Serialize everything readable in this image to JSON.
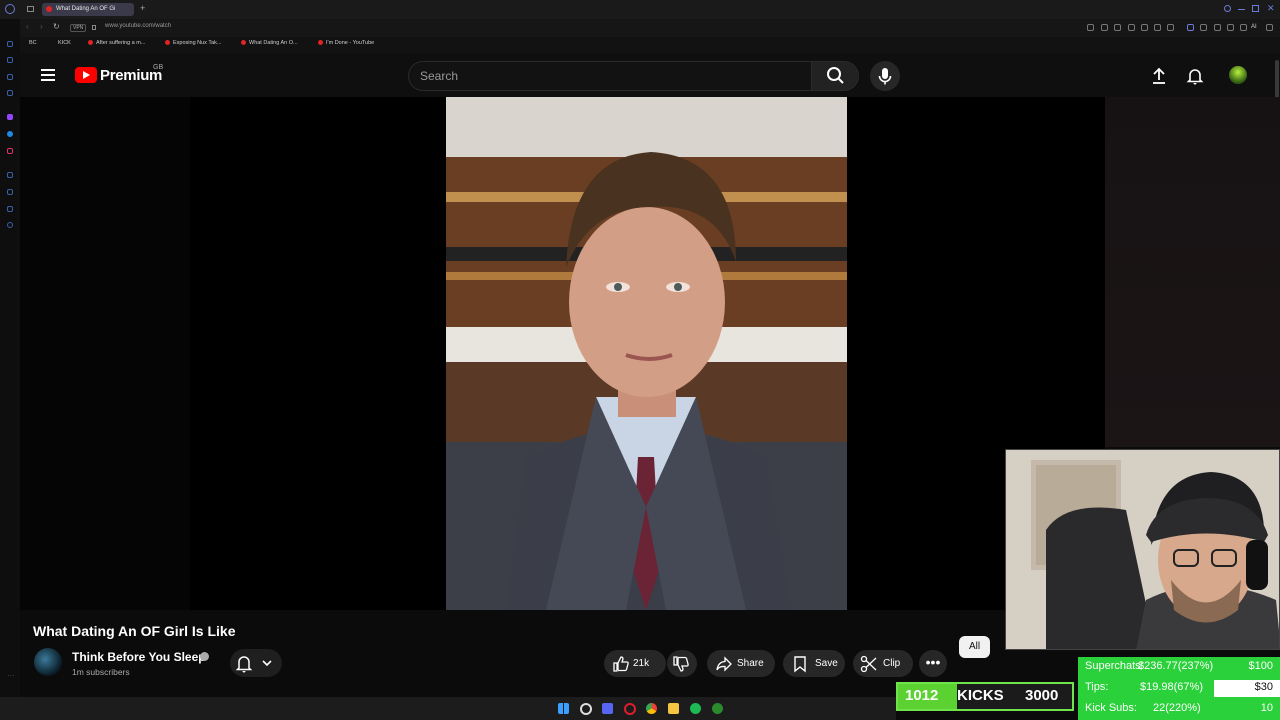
{
  "browser": {
    "tab_title": "What Dating An OF Gi",
    "url": "www.youtube.com/watch",
    "vpn_label": "VPN",
    "bookmarks": [
      "BC",
      "KICK",
      "After suffering a m...",
      "Exposing Nux Tak...",
      "What Dating An O...",
      "I'm Done - YouTube"
    ]
  },
  "header": {
    "brand": "Premium",
    "region": "GB",
    "search_placeholder": "Search"
  },
  "video": {
    "title": "What Dating An OF Girl Is Like",
    "channel": "Think Before You Sleep",
    "subscribers": "1m subscribers",
    "likes": "21k",
    "share_label": "Share",
    "save_label": "Save",
    "clip_label": "Clip",
    "chip_all": "All"
  },
  "overlay": {
    "kicks_current": "1012",
    "kicks_label": "KICKS",
    "kicks_goal": "3000",
    "kicks_progress": 0.337,
    "goals": [
      {
        "label": "Superchats:",
        "value": "$236.77(237%)",
        "target": "$100"
      },
      {
        "label": "Tips:",
        "value": "$19.98(67%)",
        "target": "$30"
      },
      {
        "label": "Kick Subs:",
        "value": "22(220%)",
        "target": "10"
      }
    ]
  },
  "colors": {
    "yt_red": "#ff0000",
    "overlay_green": "#2ad13a",
    "kicks_green": "#5cd232"
  }
}
